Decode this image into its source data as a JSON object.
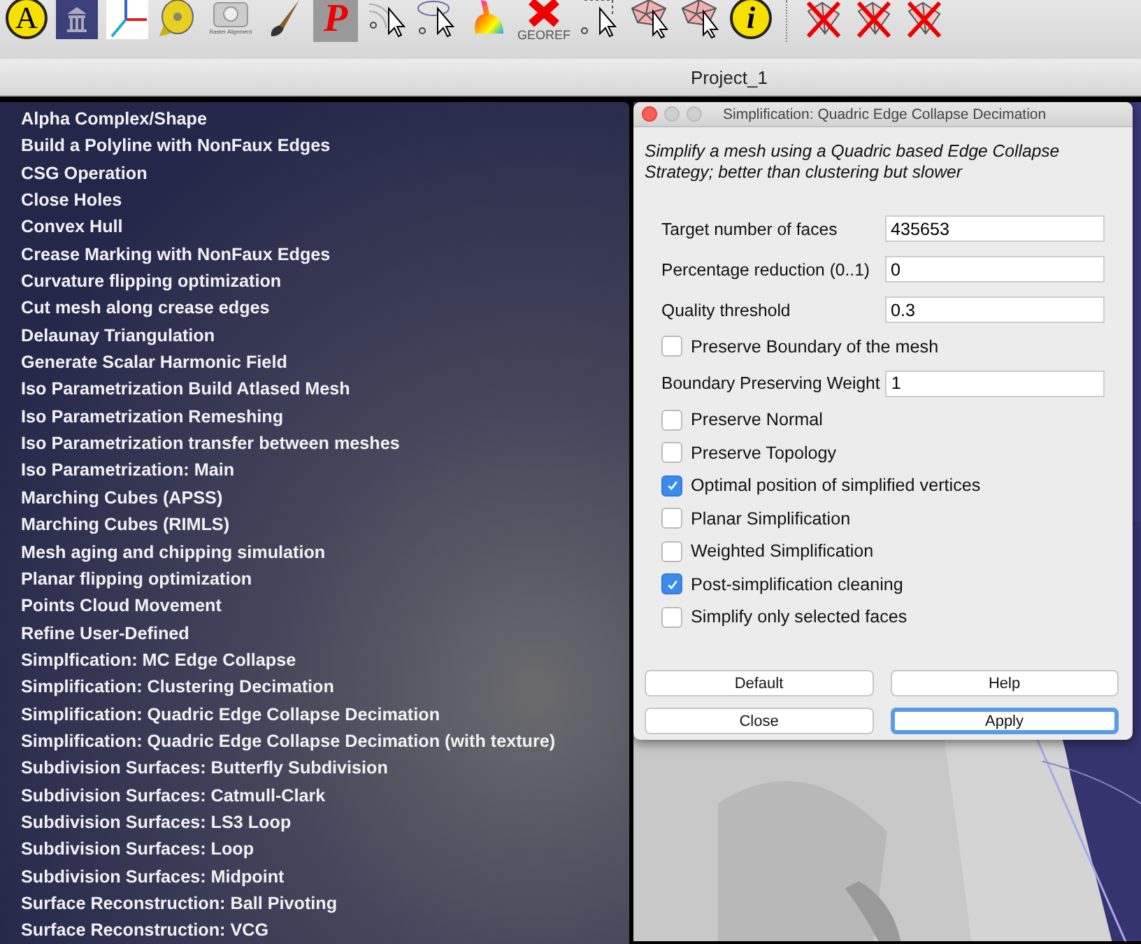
{
  "toolbar": {
    "a_button": "A",
    "raster_label": "Raster Alignment",
    "p_button": "P",
    "georef_label": "GEOREF",
    "info_button": "i"
  },
  "window": {
    "title": "Project_1"
  },
  "menu": {
    "items": [
      "Alpha Complex/Shape",
      "Build a Polyline with NonFaux Edges",
      "CSG Operation",
      "Close Holes",
      "Convex Hull",
      "Crease Marking with NonFaux Edges",
      "Curvature flipping optimization",
      "Cut mesh along crease edges",
      "Delaunay Triangulation",
      "Generate Scalar Harmonic Field",
      "Iso Parametrization Build Atlased Mesh",
      "Iso Parametrization Remeshing",
      "Iso Parametrization transfer between meshes",
      "Iso Parametrization: Main",
      "Marching Cubes (APSS)",
      "Marching Cubes (RIMLS)",
      "Mesh aging and chipping simulation",
      "Planar flipping optimization",
      "Points Cloud Movement",
      "Refine User-Defined",
      "Simplfication: MC Edge Collapse",
      "Simplification: Clustering Decimation",
      "Simplification: Quadric Edge Collapse Decimation",
      "Simplification: Quadric Edge Collapse Decimation (with texture)",
      "Subdivision Surfaces: Butterfly Subdivision",
      "Subdivision Surfaces: Catmull-Clark",
      "Subdivision Surfaces: LS3 Loop",
      "Subdivision Surfaces: Loop",
      "Subdivision Surfaces: Midpoint",
      "Surface Reconstruction: Ball Pivoting",
      "Surface Reconstruction: VCG"
    ]
  },
  "dialog": {
    "title": "Simplification: Quadric Edge Collapse Decimation",
    "description": "Simplify a mesh using a Quadric based Edge Collapse Strategy; better than clustering but slower",
    "rows": [
      {
        "kind": "field",
        "label": "Target number of faces",
        "value": "435653"
      },
      {
        "kind": "field",
        "label": "Percentage reduction (0..1)",
        "value": "0"
      },
      {
        "kind": "field",
        "label": "Quality threshold",
        "value": "0.3"
      },
      {
        "kind": "checkbox",
        "label": "Preserve Boundary of the mesh",
        "checked": false
      },
      {
        "kind": "field",
        "label": "Boundary Preserving Weight",
        "value": "1"
      },
      {
        "kind": "checkbox",
        "label": "Preserve Normal",
        "checked": false
      },
      {
        "kind": "checkbox",
        "label": "Preserve Topology",
        "checked": false
      },
      {
        "kind": "checkbox",
        "label": "Optimal position of simplified vertices",
        "checked": true
      },
      {
        "kind": "checkbox",
        "label": "Planar Simplification",
        "checked": false
      },
      {
        "kind": "checkbox",
        "label": "Weighted Simplification",
        "checked": false
      },
      {
        "kind": "checkbox",
        "label": "Post-simplification cleaning",
        "checked": true
      },
      {
        "kind": "checkbox",
        "label": "Simplify only selected faces",
        "checked": false
      }
    ],
    "buttons": [
      {
        "label": "Default",
        "default": false
      },
      {
        "label": "Help",
        "default": false
      },
      {
        "label": "Close",
        "default": false
      },
      {
        "label": "Apply",
        "default": true
      }
    ]
  }
}
